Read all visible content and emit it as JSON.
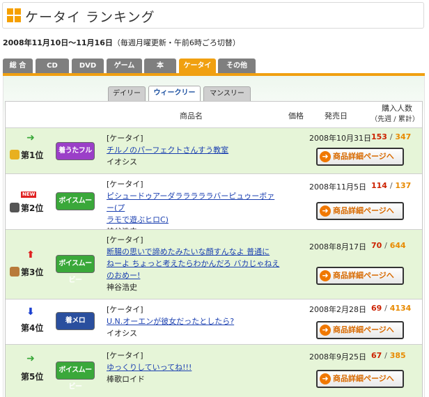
{
  "header": {
    "title": "ケータイ ランキング"
  },
  "period": {
    "range": "2008年11月10日〜11月16日",
    "note": "（毎週月曜更新・午前6時ごろ切替）"
  },
  "category_tabs": [
    "総 合",
    "CD",
    "DVD",
    "ゲーム",
    "本",
    "ケータイ",
    "その他"
  ],
  "active_category": "ケータイ",
  "sub_tabs": [
    "デイリー",
    "ウィークリー",
    "マンスリー"
  ],
  "active_sub_tab": "ウィークリー",
  "table": {
    "col_name": "商品名",
    "col_price": "価格",
    "col_date": "発売日",
    "col_buyers_1": "購入人数",
    "col_buyers_2": "（先週 / 累計）"
  },
  "detail_button_label": "商品詳細ページへ",
  "rows": [
    {
      "rank": "第1位",
      "trend": "right",
      "is_new": false,
      "type_label": "着うたフル",
      "type_color": "#9b3fc8",
      "category": "[ケータイ]",
      "title_l1": "チルノのパーフェクトさんすう教室",
      "title_l2": "",
      "title_l3": "",
      "artist": "イオシス",
      "date": "2008年10月31日",
      "week": "153",
      "sep": "/",
      "total": "347"
    },
    {
      "rank": "第2位",
      "trend": "new",
      "is_new": true,
      "new_label": "NEW",
      "type_label": "ボイスムービー",
      "type_color": "#3aa83a",
      "category": "[ケータイ]",
      "title_l1": "ピシュードゥアーダラララララバーピュゥーボァー(プ",
      "title_l2": "ラモで遊ぶヒロC)",
      "title_l3": "",
      "artist": "神谷浩史",
      "date": "2008年11月5日",
      "week": "114",
      "sep": "/",
      "total": "137"
    },
    {
      "rank": "第3位",
      "trend": "up",
      "is_new": false,
      "type_label": "ボイスムービー",
      "type_color": "#3aa83a",
      "category": "[ケータイ]",
      "title_l1": "断腸の思いで諦めたみたいな顔すんなよ 普通に",
      "title_l2": "ねーよ ちょっと考えたらわかんだろ バカじゃねえ",
      "title_l3": "のおめー!",
      "artist": "神谷浩史",
      "date": "2008年8月17日",
      "week": "70",
      "sep": "/",
      "total": "644"
    },
    {
      "rank": "第4位",
      "trend": "down",
      "is_new": false,
      "type_label": "着メロ",
      "type_color": "#2a4f9e",
      "category": "[ケータイ]",
      "title_l1": "U.N.オーエンが彼女だったとしたら?",
      "title_l2": "",
      "title_l3": "",
      "artist": "イオシス",
      "date": "2008年2月28日",
      "week": "69",
      "sep": "/",
      "total": "4134"
    },
    {
      "rank": "第5位",
      "trend": "right",
      "is_new": false,
      "type_label": "ボイスムービー",
      "type_color": "#3aa83a",
      "category": "[ケータイ]",
      "title_l1": "ゆっくりしていってね!!!",
      "title_l2": "",
      "title_l3": "",
      "artist": "棒歌ロイド",
      "date": "2008年9月25日",
      "week": "67",
      "sep": "/",
      "total": "385"
    }
  ],
  "colors": {
    "accent": "#f0a010",
    "row_green": "#e6f5d8",
    "link": "#1a3fb0",
    "week_count": "#cc2200",
    "total_count": "#e88a00"
  }
}
